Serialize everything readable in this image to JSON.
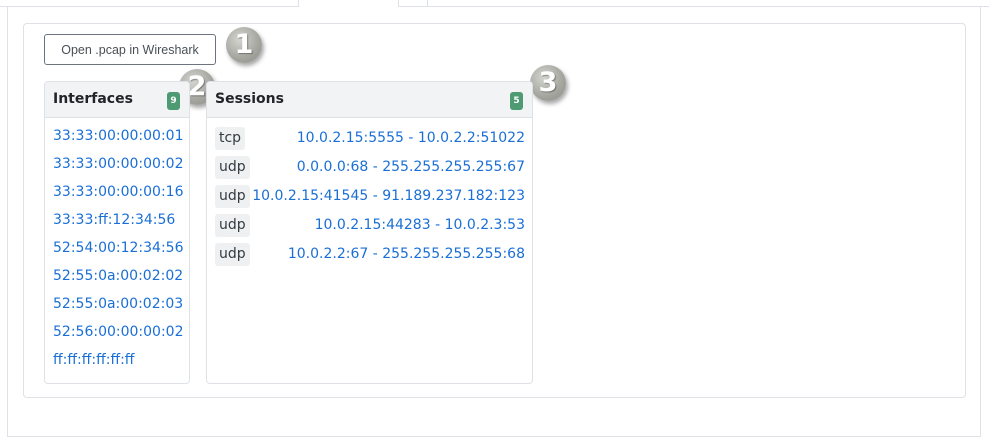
{
  "toolbar": {
    "open_pcap_label": "Open .pcap in Wireshark"
  },
  "markers": [
    "1",
    "2",
    "3"
  ],
  "interfaces": {
    "title": "Interfaces",
    "count": "9",
    "items": [
      "33:33:00:00:00:01",
      "33:33:00:00:00:02",
      "33:33:00:00:00:16",
      "33:33:ff:12:34:56",
      "52:54:00:12:34:56",
      "52:55:0a:00:02:02",
      "52:55:0a:00:02:03",
      "52:56:00:00:00:02",
      "ff:ff:ff:ff:ff:ff"
    ]
  },
  "sessions": {
    "title": "Sessions",
    "count": "5",
    "items": [
      {
        "protocol": "tcp",
        "endpoints": "10.0.2.15:5555 - 10.0.2.2:51022"
      },
      {
        "protocol": "udp",
        "endpoints": "0.0.0.0:68 - 255.255.255.255:67"
      },
      {
        "protocol": "udp",
        "endpoints": "10.0.2.15:41545 - 91.189.237.182:123"
      },
      {
        "protocol": "udp",
        "endpoints": "10.0.2.15:44283 - 10.0.2.3:53"
      },
      {
        "protocol": "udp",
        "endpoints": "10.0.2.2:67 - 255.255.255.255:68"
      }
    ]
  },
  "colors": {
    "link": "#1a6fd6",
    "badge": "#4e9a73",
    "header_bg": "#f1f3f5",
    "border": "#dee2e6"
  }
}
